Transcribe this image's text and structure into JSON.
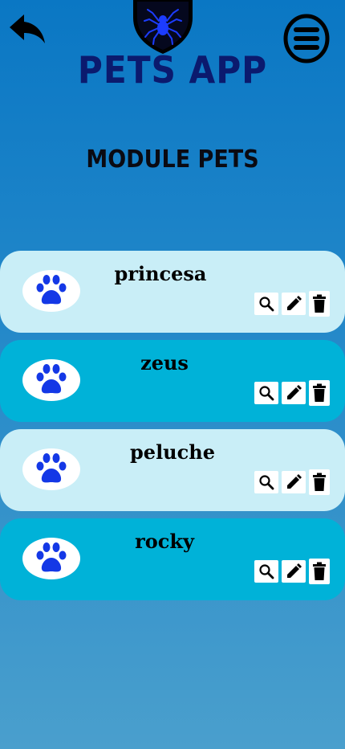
{
  "header": {
    "app_title": "PETS APP",
    "back_icon": "back-arrow-icon",
    "menu_icon": "hamburger-menu-icon",
    "logo_icon": "spider-shield-logo"
  },
  "module": {
    "title": "MODULE PETS"
  },
  "pets": [
    {
      "name": "princesa",
      "variant": "light"
    },
    {
      "name": "zeus",
      "variant": "dark"
    },
    {
      "name": "peluche",
      "variant": "light"
    },
    {
      "name": "rocky",
      "variant": "dark"
    }
  ],
  "actions": {
    "view_icon": "search-icon",
    "edit_icon": "pencil-icon",
    "delete_icon": "trash-icon"
  },
  "colors": {
    "card_light": "#c9eef7",
    "card_dark": "#00b2d8",
    "title": "#0b1a6e",
    "paw": "#1438e6"
  }
}
